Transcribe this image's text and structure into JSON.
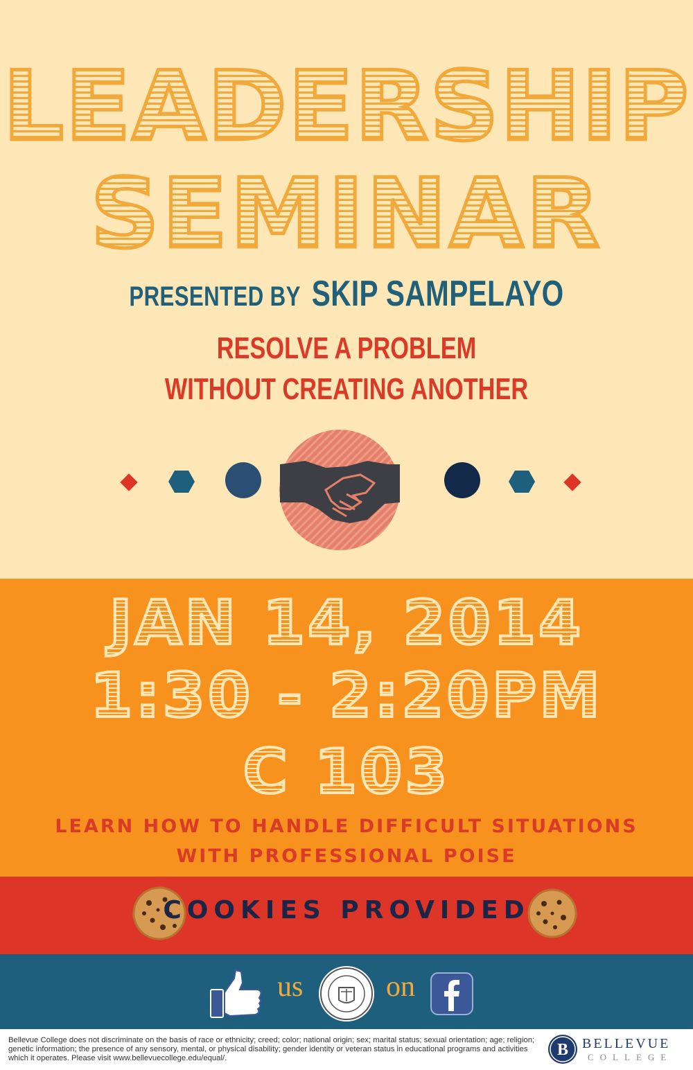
{
  "poster": {
    "title_line1": "LEADERSHIP",
    "title_line2": "SEMINAR",
    "presented_by_label": "PRESENTED BY",
    "presenter": "SKIP SAMPELAYO",
    "tagline_line1": "RESOLVE A PROBLEM",
    "tagline_line2": "WITHOUT CREATING ANOTHER",
    "icon": "handshake-icon"
  },
  "event": {
    "date": "JAN 14, 2014",
    "time": "1:30 - 2:20PM",
    "room": "C 103",
    "description_line1": "LEARN HOW TO HANDLE DIFFICULT SITUATIONS",
    "description_line2": "WITH PROFESSIONAL POISE"
  },
  "cookies": {
    "text": "COOKIES PROVIDED",
    "icon": "cookie-icon"
  },
  "social": {
    "like_icon": "thumbs-up-icon",
    "us_text": "us",
    "on_text": "on",
    "seal_icon": "college-seal-icon",
    "facebook_icon": "facebook-icon"
  },
  "footer": {
    "disclaimer": "Bellevue College does not discriminate on the basis of race or ethnicity; creed; color; national origin; sex; marital status; sexual orientation; age; religion; genetic information; the presence of any sensory, mental, or physical disability; gender identity or veteran status in educational programs and activities which it operates. Please visit www.bellevuecollege.edu/equal/.",
    "college_name": "BELLEVUE",
    "college_sub": "COLLEGE",
    "logo_letter": "B"
  },
  "colors": {
    "cream": "#fde7b6",
    "title_orange": "#f2a93b",
    "teal": "#21607a",
    "red": "#dd3629",
    "orange_band": "#f7921e",
    "navy": "#1a2547",
    "salmon": "#e4806a"
  }
}
